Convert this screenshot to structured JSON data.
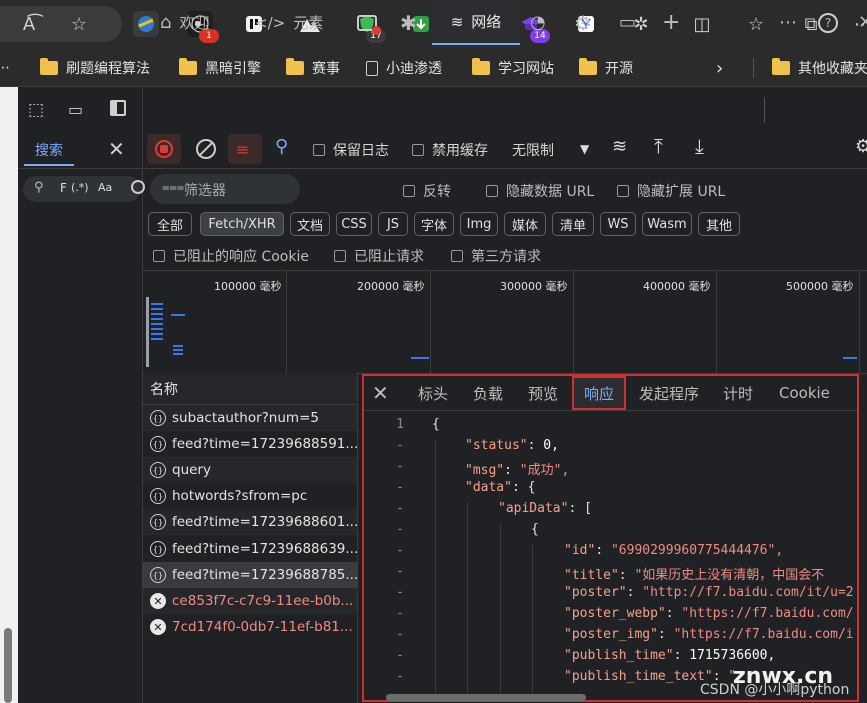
{
  "topbar": {
    "badges": [
      "1",
      "17",
      "14"
    ]
  },
  "bookmarks": [
    {
      "label": "刷题编程算法",
      "kind": "folder"
    },
    {
      "label": "黑暗引擎",
      "kind": "folder"
    },
    {
      "label": "赛事",
      "kind": "folder"
    },
    {
      "label": "小迪渗透",
      "kind": "page"
    },
    {
      "label": "学习网站",
      "kind": "folder"
    },
    {
      "label": "开源",
      "kind": "folder"
    },
    {
      "label": "其他收藏夹",
      "kind": "folder"
    }
  ],
  "search_panel": {
    "tab_label": "搜索",
    "input_value": "F",
    "regex_toggle": "(.*)",
    "case_toggle": "Aa"
  },
  "devtools_tabs": [
    {
      "label": "欢迎"
    },
    {
      "label": "元素"
    },
    {
      "label": "网络",
      "active": true
    }
  ],
  "network_toolbar": {
    "preserve_log": "保留日志",
    "disable_cache": "禁用缓存",
    "throttling": "无限制"
  },
  "filter": {
    "placeholder": "筛选器",
    "invert": "反转",
    "hide_data_urls": "隐藏数据 URL",
    "hide_ext_urls": "隐藏扩展 URL",
    "types": [
      "全部",
      "Fetch/XHR",
      "文档",
      "CSS",
      "JS",
      "字体",
      "Img",
      "媒体",
      "清单",
      "WS",
      "Wasm",
      "其他"
    ],
    "selected_type": "Fetch/XHR",
    "blocked_cookies": "已阻止的响应 Cookie",
    "blocked_requests": "已阻止请求",
    "third_party": "第三方请求"
  },
  "timeline": {
    "ticks": [
      "100000 毫秒",
      "200000 毫秒",
      "300000 毫秒",
      "400000 毫秒",
      "500000 毫秒"
    ]
  },
  "request_list": {
    "header": "名称",
    "items": [
      {
        "name": "subactauthor?num=5",
        "status": "xhr"
      },
      {
        "name": "feed?time=17239688591...",
        "status": "xhr"
      },
      {
        "name": "query",
        "status": "xhr"
      },
      {
        "name": "hotwords?sfrom=pc",
        "status": "xhr"
      },
      {
        "name": "feed?time=17239688601...",
        "status": "xhr"
      },
      {
        "name": "feed?time=17239688639...",
        "status": "xhr"
      },
      {
        "name": "feed?time=17239688785...",
        "status": "xhr",
        "selected": true
      },
      {
        "name": "ce853f7c-c7c9-11ee-b0b...",
        "status": "error"
      },
      {
        "name": "7cd174f0-0db7-11ef-b81...",
        "status": "error"
      }
    ]
  },
  "response_panel": {
    "tabs": [
      "标头",
      "负载",
      "预览",
      "响应",
      "发起程序",
      "计时",
      "Cookie"
    ],
    "active_tab": "响应",
    "line_numbers": [
      "1",
      "-",
      "-",
      "-",
      "-",
      "-",
      "-",
      "-",
      "-",
      "-",
      "-",
      "-",
      "-",
      "-"
    ],
    "code_lines": [
      {
        "indent": 0,
        "key": "",
        "value": "{",
        "vtype": "punct"
      },
      {
        "indent": 1,
        "key": "\"status\"",
        "value": "0,",
        "vtype": "num"
      },
      {
        "indent": 1,
        "key": "\"msg\"",
        "value": "\"成功\",",
        "vtype": "str"
      },
      {
        "indent": 1,
        "key": "\"data\"",
        "value": "{",
        "vtype": "punct"
      },
      {
        "indent": 2,
        "key": "\"apiData\"",
        "value": "[",
        "vtype": "punct"
      },
      {
        "indent": 3,
        "key": "",
        "value": "{",
        "vtype": "punct"
      },
      {
        "indent": 4,
        "key": "\"id\"",
        "value": "\"6990299960775444476\",",
        "vtype": "str"
      },
      {
        "indent": 4,
        "key": "\"title\"",
        "value": "\"如果历史上没有清朝，中国会不",
        "vtype": "str"
      },
      {
        "indent": 4,
        "key": "\"poster\"",
        "value": "\"http://f7.baidu.com/it/u=2",
        "vtype": "str"
      },
      {
        "indent": 4,
        "key": "\"poster_webp\"",
        "value": "\"https://f7.baidu.com/",
        "vtype": "str"
      },
      {
        "indent": 4,
        "key": "\"poster_img\"",
        "value": "\"https://f7.baidu.com/i",
        "vtype": "str"
      },
      {
        "indent": 4,
        "key": "\"publish_time\"",
        "value": "1715736600,",
        "vtype": "num"
      },
      {
        "indent": 4,
        "key": "\"publish_time_text\"",
        "value": "\"",
        "vtype": "str"
      }
    ]
  },
  "watermark": {
    "site": "znwx.cn",
    "author": "CSDN @小小啊python"
  },
  "colors": {
    "accent": "#7cacf8",
    "highlight_border": "#d03030",
    "json_key": "#f9a08b",
    "json_string": "#f28b82"
  }
}
